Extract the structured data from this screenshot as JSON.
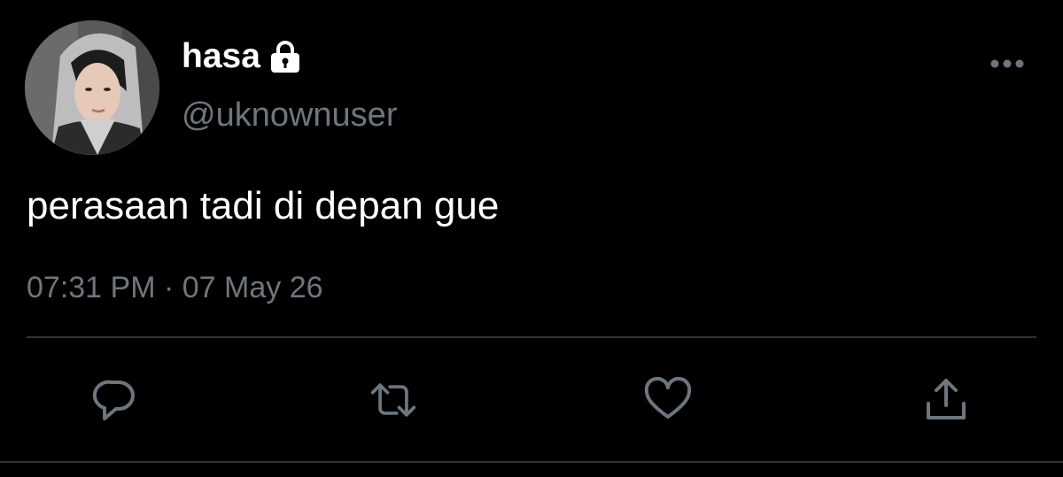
{
  "user": {
    "display_name": "hasa",
    "handle": "@uknownuser",
    "protected_icon": "lock-icon",
    "avatar": "profile-photo"
  },
  "tweet": {
    "text": "perasaan tadi di depan gue",
    "time": "07:31 PM",
    "separator": "·",
    "date": "07 May 26"
  },
  "actions": {
    "more": "more-horizontal-icon",
    "reply": "reply-icon",
    "retweet": "retweet-icon",
    "like": "heart-icon",
    "share": "share-icon"
  },
  "colors": {
    "background": "#000000",
    "primary_text": "#ffffff",
    "secondary_text": "#6e767d",
    "divider": "#2f3336"
  }
}
